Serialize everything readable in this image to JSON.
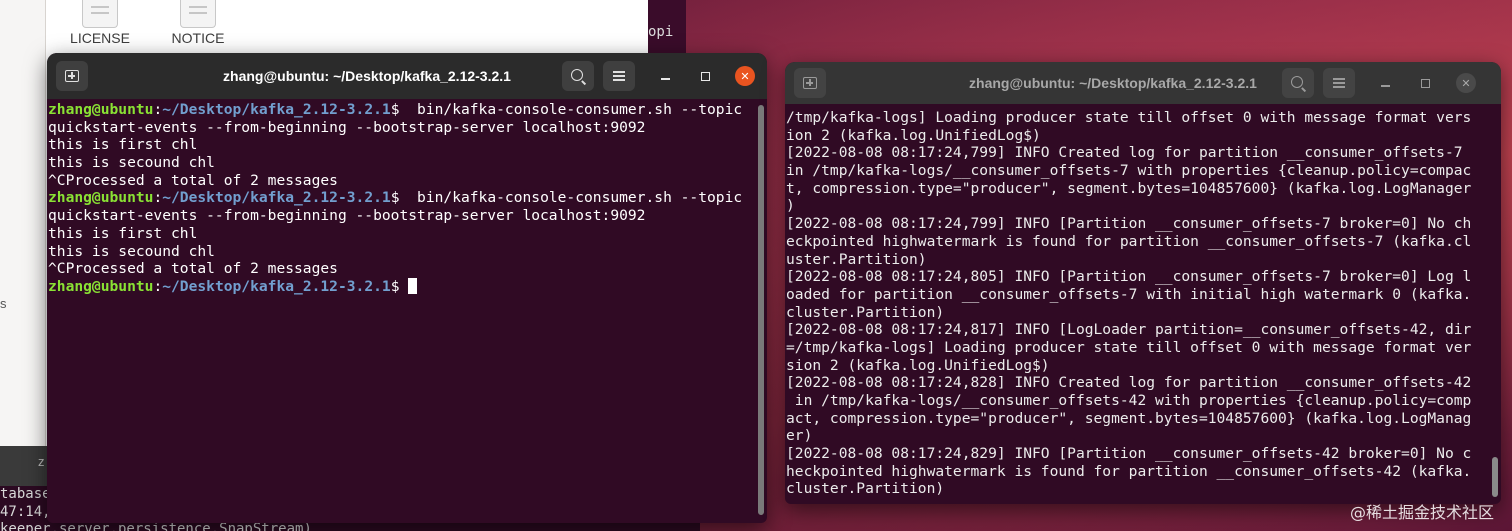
{
  "file_manager": {
    "files": [
      {
        "name": "LICENSE",
        "icon": "text-file-icon"
      },
      {
        "name": "NOTICE",
        "icon": "text-file-icon"
      }
    ],
    "side_fragment": "s"
  },
  "behind_terminal": {
    "fragment_right": "opi",
    "tab_fragment": "z",
    "lines": [
      "tabase",
      "47:14,",
      "keeper.server.persistence.SnapStream)"
    ]
  },
  "active_terminal": {
    "title": "zhang@ubuntu: ~/Desktop/kafka_2.12-3.2.1",
    "prompt_user": "zhang@ubuntu",
    "prompt_sep": ":",
    "prompt_path": "~/Desktop/kafka_2.12-3.2.1",
    "prompt_end": "$",
    "lines": [
      {
        "type": "prompt",
        "cmd": "  bin/kafka-console-consumer.sh --topic"
      },
      {
        "type": "text",
        "text": "quickstart-events --from-beginning --bootstrap-server localhost:9092"
      },
      {
        "type": "text",
        "text": "this is first chl"
      },
      {
        "type": "text",
        "text": "this is secound chl"
      },
      {
        "type": "text",
        "text": "^CProcessed a total of 2 messages"
      },
      {
        "type": "prompt",
        "cmd": "  bin/kafka-console-consumer.sh --topic"
      },
      {
        "type": "text",
        "text": "quickstart-events --from-beginning --bootstrap-server localhost:9092"
      },
      {
        "type": "text",
        "text": "this is first chl"
      },
      {
        "type": "text",
        "text": "this is secound chl"
      },
      {
        "type": "text",
        "text": "^CProcessed a total of 2 messages"
      },
      {
        "type": "prompt",
        "cmd": " ",
        "cursor": true
      }
    ]
  },
  "inactive_terminal": {
    "title": "zhang@ubuntu: ~/Desktop/kafka_2.12-3.2.1",
    "lines": [
      "/tmp/kafka-logs] Loading producer state till offset 0 with message format vers",
      "ion 2 (kafka.log.UnifiedLog$)",
      "[2022-08-08 08:17:24,799] INFO Created log for partition __consumer_offsets-7",
      "in /tmp/kafka-logs/__consumer_offsets-7 with properties {cleanup.policy=compac",
      "t, compression.type=\"producer\", segment.bytes=104857600} (kafka.log.LogManager",
      ")",
      "[2022-08-08 08:17:24,799] INFO [Partition __consumer_offsets-7 broker=0] No ch",
      "eckpointed highwatermark is found for partition __consumer_offsets-7 (kafka.cl",
      "uster.Partition)",
      "[2022-08-08 08:17:24,805] INFO [Partition __consumer_offsets-7 broker=0] Log l",
      "oaded for partition __consumer_offsets-7 with initial high watermark 0 (kafka.",
      "cluster.Partition)",
      "[2022-08-08 08:17:24,817] INFO [LogLoader partition=__consumer_offsets-42, dir",
      "=/tmp/kafka-logs] Loading producer state till offset 0 with message format ver",
      "sion 2 (kafka.log.UnifiedLog$)",
      "[2022-08-08 08:17:24,828] INFO Created log for partition __consumer_offsets-42",
      " in /tmp/kafka-logs/__consumer_offsets-42 with properties {cleanup.policy=comp",
      "act, compression.type=\"producer\", segment.bytes=104857600} (kafka.log.LogManag",
      "er)",
      "[2022-08-08 08:17:24,829] INFO [Partition __consumer_offsets-42 broker=0] No c",
      "heckpointed highwatermark is found for partition __consumer_offsets-42 (kafka.",
      "cluster.Partition)"
    ]
  },
  "watermark": "@稀土掘金技术社区",
  "colors": {
    "terminal_bg": "#300a24",
    "prompt_user": "#8ae234",
    "prompt_path": "#729fcf",
    "close_button": "#e95420"
  }
}
